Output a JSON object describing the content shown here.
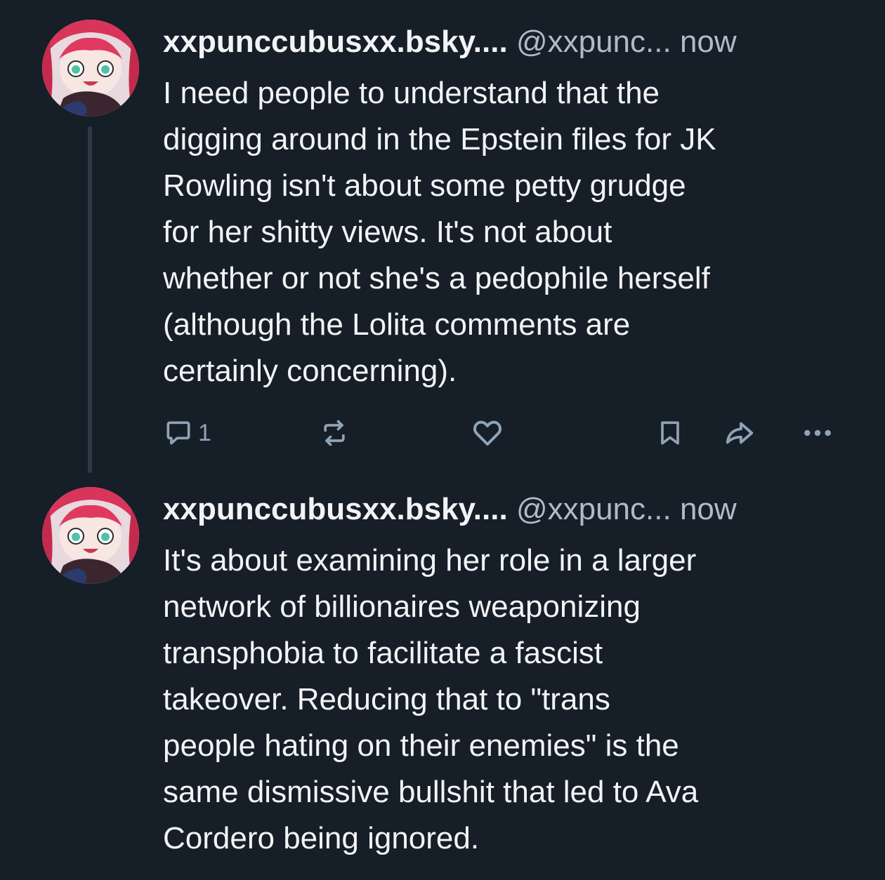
{
  "posts": [
    {
      "author": {
        "display_name": "xxpunccubusxx.bsky....",
        "handle": "@xxpunc...",
        "time": "now",
        "avatar_icon": "anime-avatar-red-hair"
      },
      "text": "I need people to understand that the\ndigging around in the Epstein files for JK\nRowling isn't about some petty grudge\nfor her shitty views.  It's not about\nwhether or not she's a pedophile herself\n(although the Lolita comments are\ncertainly concerning).",
      "actions": {
        "reply_count": "1",
        "reply_icon": "reply-icon",
        "repost_icon": "repost-icon",
        "like_icon": "heart-icon",
        "bookmark_icon": "bookmark-icon",
        "share_icon": "share-icon",
        "more_icon": "more-icon"
      }
    },
    {
      "author": {
        "display_name": "xxpunccubusxx.bsky....",
        "handle": "@xxpunc...",
        "time": "now",
        "avatar_icon": "anime-avatar-red-hair"
      },
      "text": "It's about examining her role in a larger\nnetwork of billionaires weaponizing\ntransphobia to facilitate a fascist\ntakeover. Reducing that to \"trans\npeople hating on their enemies\" is the\nsame dismissive bullshit that led to Ava\nCordero being ignored."
    }
  ],
  "colors": {
    "background": "#161e27",
    "text_primary": "#f1f3f5",
    "text_secondary": "#aebbc9",
    "icon": "#8fa3b8",
    "thread_line": "#2e3a4a"
  }
}
